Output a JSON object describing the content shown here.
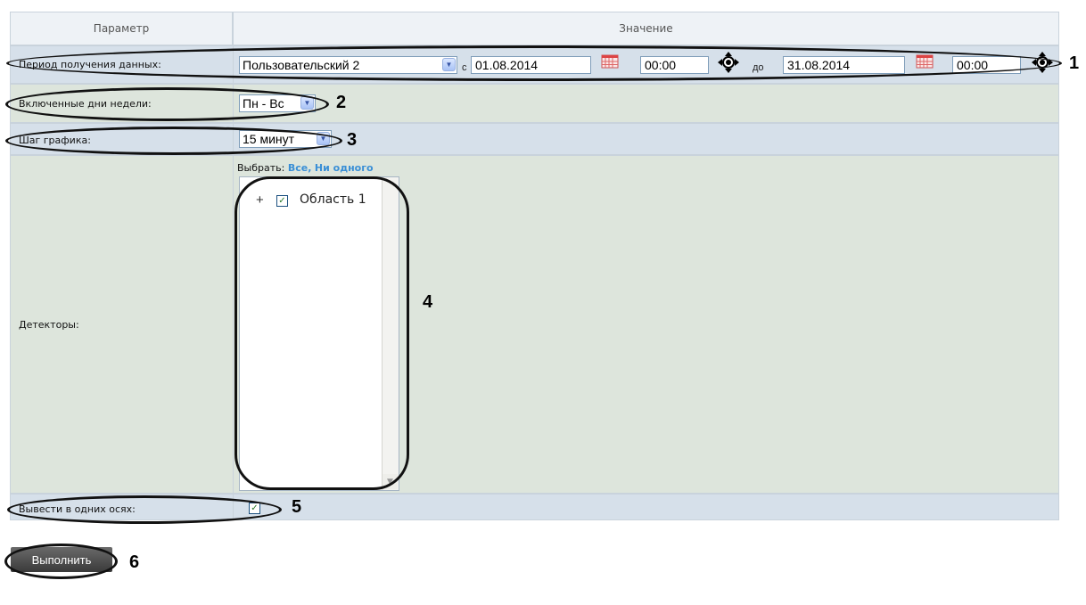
{
  "header": {
    "param": "Параметр",
    "value": "Значение"
  },
  "period": {
    "label": "Период получения данных:",
    "preset": "Пользовательский 2",
    "from_word": "с",
    "from_date": "01.08.2014",
    "from_time": "00:00",
    "to_word": "до",
    "to_date": "31.08.2014",
    "to_time": "00:00"
  },
  "days": {
    "label": "Включенные дни недели:",
    "value": "Пн - Вс"
  },
  "step": {
    "label": "Шаг графика:",
    "value": "15 минут"
  },
  "detectors": {
    "label": "Детекторы:",
    "choose_label": "Выбрать:",
    "all_link": "Все,",
    "none_link": "Ни одного",
    "tree_expand": "+",
    "tree_item": "Область 1"
  },
  "single_axes": {
    "label": "Вывести в одних осях:",
    "checked": true
  },
  "run_button": "Выполнить",
  "callouts": [
    "1",
    "2",
    "3",
    "4",
    "5",
    "6"
  ]
}
